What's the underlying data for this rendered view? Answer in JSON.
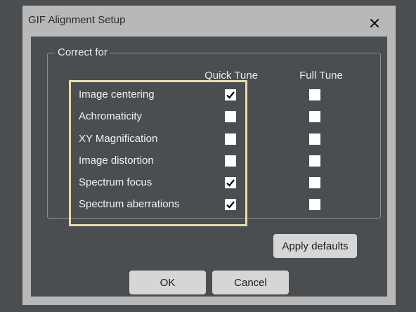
{
  "window": {
    "title": "GIF Alignment Setup",
    "close_icon": "close-icon"
  },
  "group": {
    "legend": "Correct for",
    "columns": {
      "quick_tune": "Quick Tune",
      "full_tune": "Full Tune"
    },
    "rows": [
      {
        "label": "Image centering",
        "quick_tune": true,
        "full_tune": false
      },
      {
        "label": "Achromaticity",
        "quick_tune": false,
        "full_tune": false
      },
      {
        "label": "XY Magnification",
        "quick_tune": false,
        "full_tune": false
      },
      {
        "label": "Image distortion",
        "quick_tune": false,
        "full_tune": false
      },
      {
        "label": "Spectrum focus",
        "quick_tune": true,
        "full_tune": false
      },
      {
        "label": "Spectrum aberrations",
        "quick_tune": true,
        "full_tune": false
      }
    ]
  },
  "buttons": {
    "apply_defaults": "Apply defaults",
    "ok": "OK",
    "cancel": "Cancel"
  },
  "colors": {
    "background": "#4b4e51",
    "dialog_frame": "#b8b8b8",
    "highlight_border": "#e7ddaa",
    "button_face": "#d6d6d6"
  }
}
